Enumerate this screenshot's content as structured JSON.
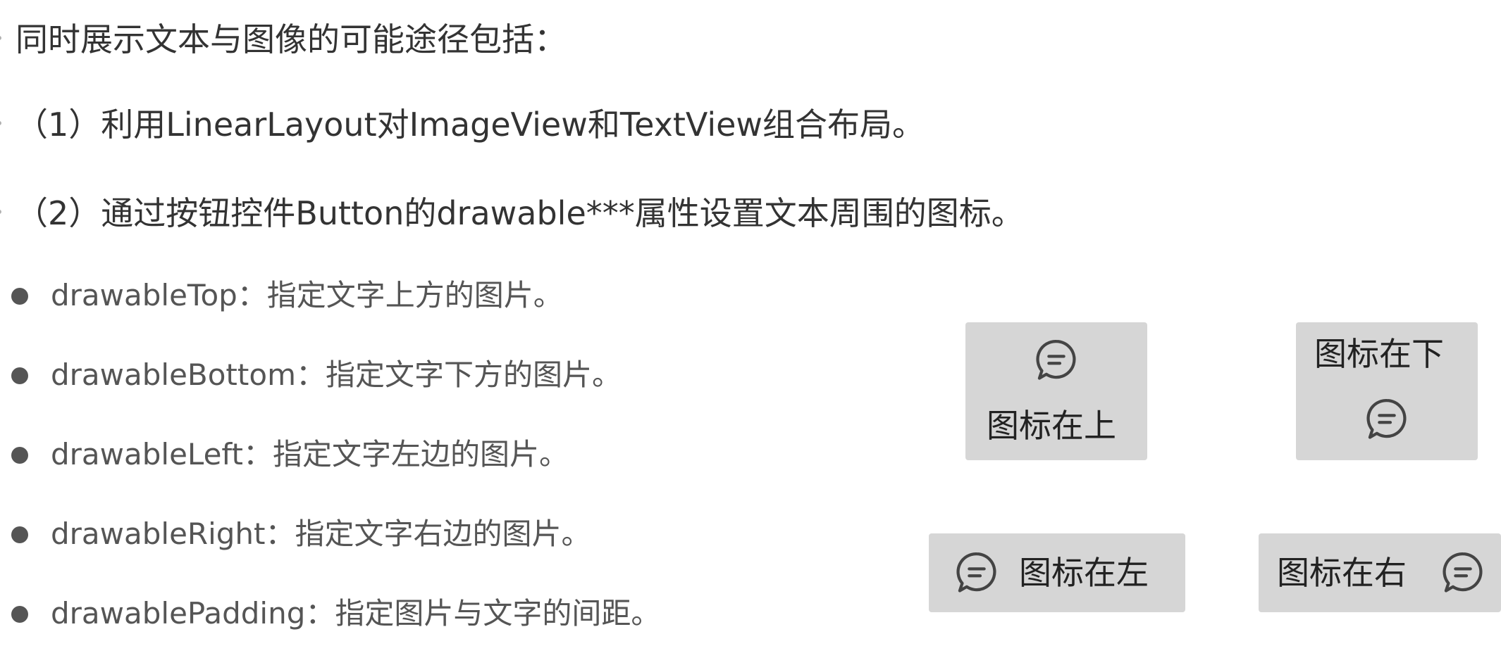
{
  "intro": {
    "heading": "同时展示文本与图像的可能途径包括：",
    "way1": "（1）利用LinearLayout对ImageView和TextView组合布局。",
    "way2": "（2）通过按钮控件Button的drawable***属性设置文本周围的图标。"
  },
  "bullets": [
    {
      "text": "drawableTop：指定文字上方的图片。"
    },
    {
      "text": "drawableBottom：指定文字下方的图片。"
    },
    {
      "text": "drawableLeft：指定文字左边的图片。"
    },
    {
      "text": "drawableRight：指定文字右边的图片。"
    },
    {
      "text": "drawablePadding：指定图片与文字的间距。"
    }
  ],
  "demo_buttons": {
    "top": {
      "label": "图标在上",
      "icon": "chat-bubble-icon"
    },
    "bottom": {
      "label": "图标在下",
      "icon": "chat-bubble-icon"
    },
    "left": {
      "label": "图标在左",
      "icon": "chat-bubble-icon"
    },
    "right": {
      "label": "图标在右",
      "icon": "chat-bubble-icon"
    }
  },
  "colors": {
    "text_main": "#333333",
    "text_bullet": "#555555",
    "button_bg": "#d6d6d6",
    "icon_stroke": "#444444"
  }
}
